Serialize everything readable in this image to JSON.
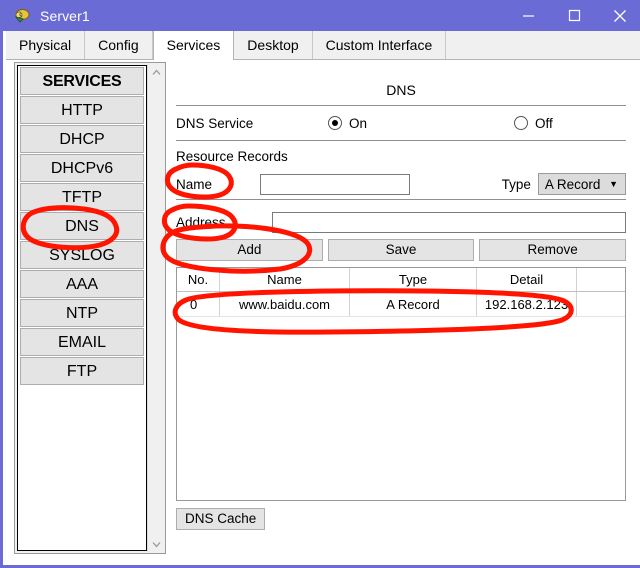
{
  "window": {
    "title": "Server1",
    "icon": "packet-tracer-server-icon",
    "titlebar_color": "#6B6BD6",
    "controls": {
      "minimize": "minimize-icon",
      "maximize": "maximize-icon",
      "close": "close-icon"
    }
  },
  "tabs": [
    {
      "label": "Physical",
      "active": false
    },
    {
      "label": "Config",
      "active": false
    },
    {
      "label": "Services",
      "active": true
    },
    {
      "label": "Desktop",
      "active": false
    },
    {
      "label": "Custom Interface",
      "active": false
    }
  ],
  "sidebar": {
    "header": "SERVICES",
    "items": [
      {
        "label": "HTTP"
      },
      {
        "label": "DHCP"
      },
      {
        "label": "DHCPv6"
      },
      {
        "label": "TFTP"
      },
      {
        "label": "DNS"
      },
      {
        "label": "SYSLOG"
      },
      {
        "label": "AAA"
      },
      {
        "label": "NTP"
      },
      {
        "label": "EMAIL"
      },
      {
        "label": "FTP"
      }
    ],
    "scrollbar": {
      "up": "chevron-up-icon",
      "down": "chevron-down-icon"
    }
  },
  "dns": {
    "title": "DNS",
    "service_label": "DNS Service",
    "service_on_label": "On",
    "service_off_label": "Off",
    "service_state": "On",
    "resource_records_label": "Resource Records",
    "name_label": "Name",
    "name_value": "",
    "name_placeholder": "",
    "type_label": "Type",
    "type_value": "A Record",
    "type_arrow": "chevron-down-icon",
    "address_label": "Address",
    "address_value": "",
    "address_placeholder": "",
    "buttons": {
      "add": "Add",
      "save": "Save",
      "remove": "Remove"
    },
    "table": {
      "columns": [
        "No.",
        "Name",
        "Type",
        "Detail"
      ],
      "rows": [
        {
          "no": "0",
          "name": "www.baidu.com",
          "type": "A Record",
          "detail": "192.168.2.123"
        }
      ]
    },
    "cache_button": "DNS Cache"
  },
  "annotations": {
    "color": "#FF0000",
    "marks": [
      "circle-dns-sidebar-item",
      "circle-name-label",
      "circle-address-label",
      "circle-add-button",
      "circle-record-row"
    ]
  }
}
